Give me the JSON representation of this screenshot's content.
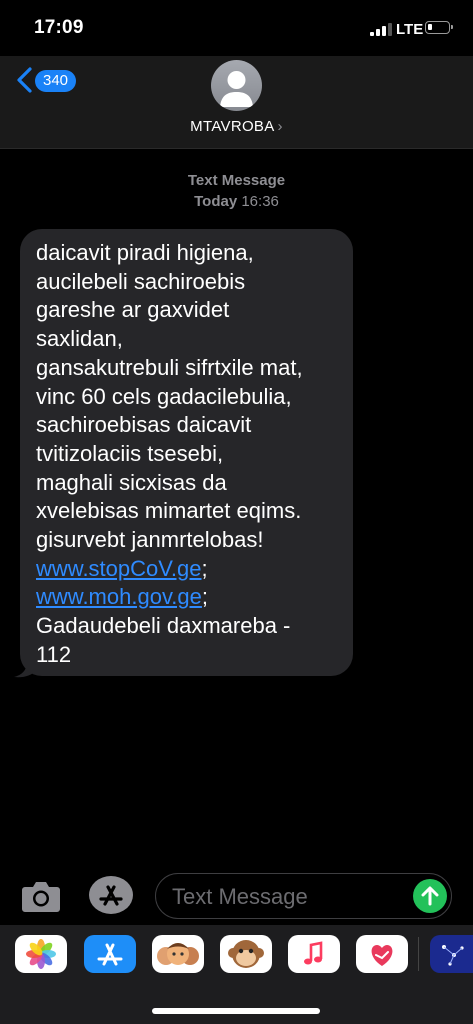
{
  "status_bar": {
    "time": "17:09",
    "network": "LTE"
  },
  "header": {
    "back_count": "340",
    "contact_name": "MTAVROBA",
    "contact_chevron": "›"
  },
  "thread": {
    "meta_label": "Text Message",
    "meta_day": "Today",
    "meta_time": "16:36",
    "message_lines": [
      "daicavit piradi higiena,",
      "aucilebeli sachiroebis",
      "gareshe ar gaxvidet",
      "saxlidan,",
      "gansakutrebuli sifrtxile mat,",
      "vinc 60 cels gadacilebulia,",
      "sachiroebisas daicavit",
      "tvitizolaciis tsesebi,",
      "maghali sicxisas da",
      "xvelebisas mimartet eqims.",
      "gisurvebt janmrtelobas!"
    ],
    "link1": "www.stopCoV.ge",
    "link1_suffix": ";",
    "link2": "www.moh.gov.ge",
    "link2_suffix": ";",
    "closing_lines": [
      "Gadaudebeli daxmareba -",
      "112"
    ]
  },
  "composer": {
    "placeholder": "Text Message"
  },
  "app_drawer": {
    "apps": [
      "photos-app",
      "app-store-app",
      "memoji-stickers-app",
      "animoji-app",
      "music-app",
      "digital-touch-app",
      "stars-app"
    ]
  },
  "colors": {
    "accent": "#1a82f7",
    "link": "#2f8bff",
    "send": "#23c15a",
    "bubble": "#262629"
  }
}
